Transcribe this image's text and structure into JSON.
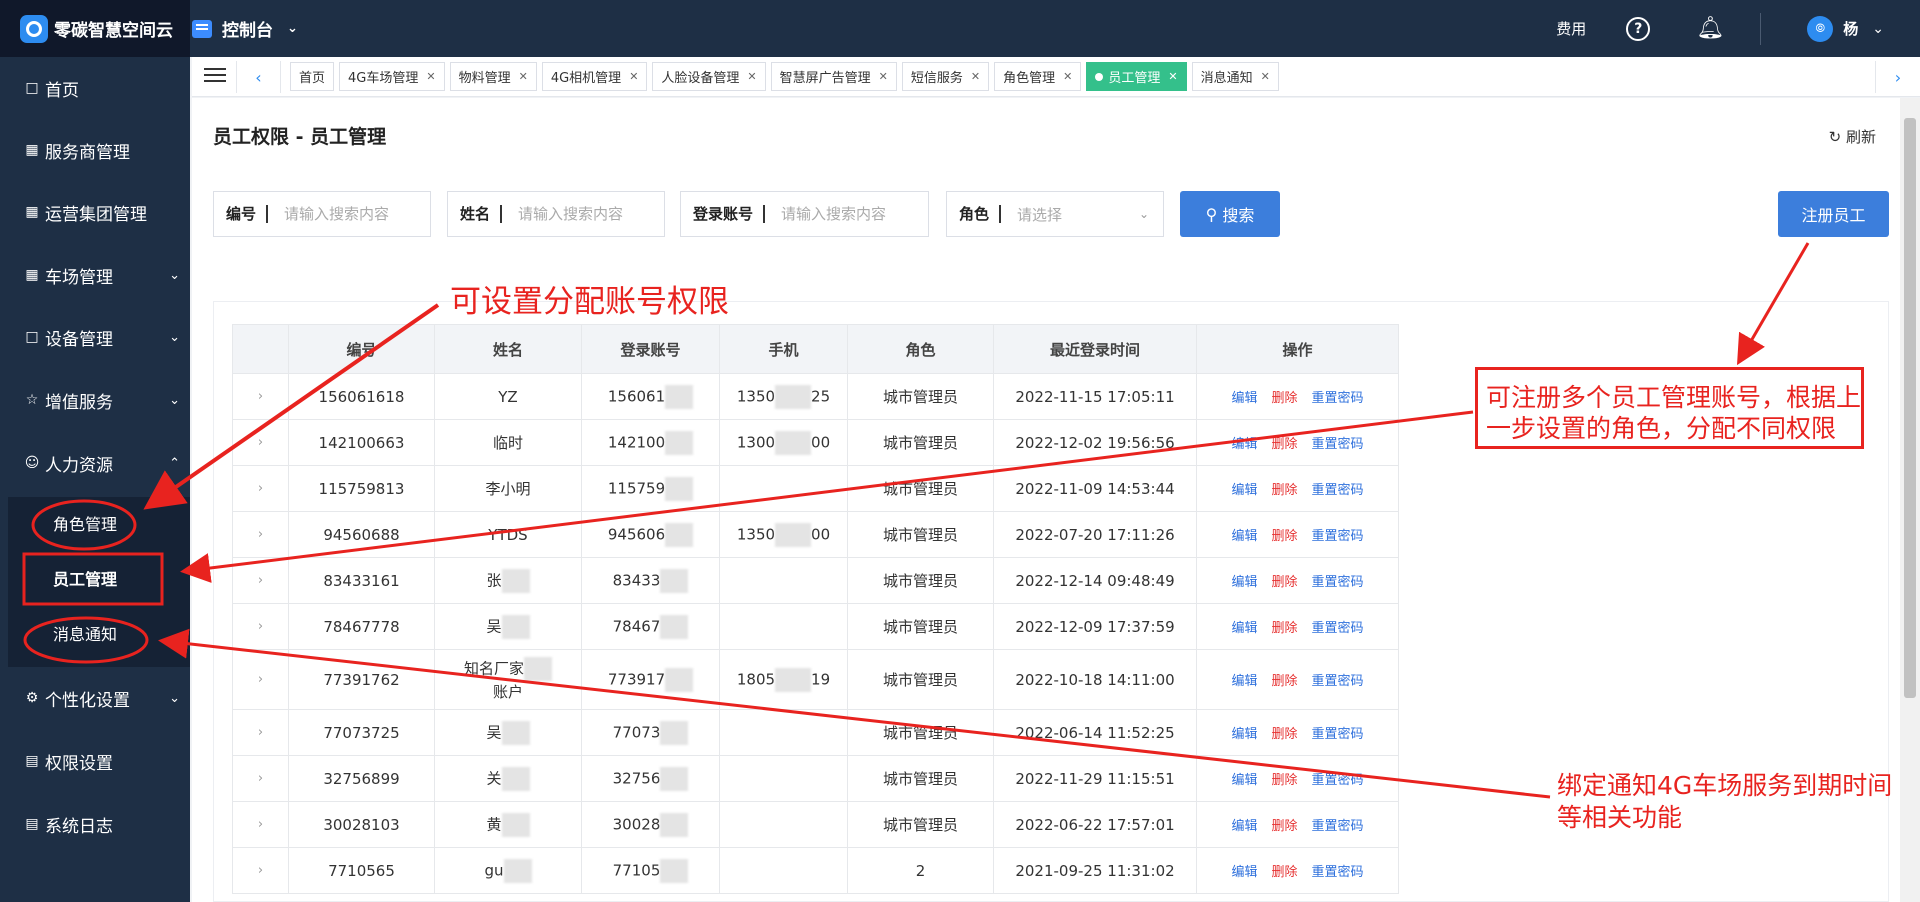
{
  "app": {
    "name": "零碳智慧空间云",
    "console_label": "控制台"
  },
  "topbar": {
    "fee_label": "费用",
    "help_label": "?",
    "user_name": "杨"
  },
  "sidebar": {
    "items": [
      {
        "label": "首页",
        "icon": "home-icon"
      },
      {
        "label": "服务商管理",
        "icon": "grid-icon"
      },
      {
        "label": "运营集团管理",
        "icon": "grid-icon"
      },
      {
        "label": "车场管理",
        "icon": "grid-icon"
      },
      {
        "label": "设备管理",
        "icon": "device-icon"
      },
      {
        "label": "增值服务",
        "icon": "star-icon"
      },
      {
        "label": "人力资源",
        "icon": "people-icon"
      },
      {
        "label": "个性化设置",
        "icon": "gear-icon"
      },
      {
        "label": "权限设置",
        "icon": "doc-icon"
      },
      {
        "label": "系统日志",
        "icon": "doc-icon"
      }
    ],
    "sub_items": [
      {
        "label": "角色管理"
      },
      {
        "label": "员工管理"
      },
      {
        "label": "消息通知"
      }
    ]
  },
  "tabs": [
    {
      "label": "首页"
    },
    {
      "label": "4G车场管理"
    },
    {
      "label": "物料管理"
    },
    {
      "label": "4G相机管理"
    },
    {
      "label": "人脸设备管理"
    },
    {
      "label": "智慧屏广告管理"
    },
    {
      "label": "短信服务"
    },
    {
      "label": "角色管理"
    },
    {
      "label": "员工管理"
    },
    {
      "label": "消息通知"
    }
  ],
  "page": {
    "title": "员工权限 - 员工管理",
    "refresh_label": "刷新",
    "filters": {
      "id_label": "编号",
      "id_placeholder": "请输入搜索内容",
      "name_label": "姓名",
      "name_placeholder": "请输入搜索内容",
      "account_label": "登录账号",
      "account_placeholder": "请输入搜索内容",
      "role_label": "角色",
      "role_placeholder": "请选择"
    },
    "search_label": "搜索",
    "register_label": "注册员工"
  },
  "table": {
    "headers": [
      "编号",
      "姓名",
      "登录账号",
      "手机",
      "角色",
      "最近登录时间",
      "操作"
    ],
    "actions": {
      "edit": "编辑",
      "delete": "删除",
      "reset": "重置密码"
    },
    "rows": [
      {
        "id": "156061618",
        "name": "YZ",
        "account": "156061",
        "phone_a": "1350",
        "phone_b": "25",
        "role": "城市管理员",
        "time": "2022-11-15 17:05:11"
      },
      {
        "id": "142100663",
        "name": "临时",
        "account": "142100",
        "phone_a": "1300",
        "phone_b": "00",
        "role": "城市管理员",
        "time": "2022-12-02 19:56:56"
      },
      {
        "id": "115759813",
        "name": "李小明",
        "account": "115759",
        "phone_a": "",
        "phone_b": "",
        "role": "城市管理员",
        "time": "2022-11-09 14:53:44"
      },
      {
        "id": "94560688",
        "name": "YTDS",
        "account": "945606",
        "phone_a": "1350",
        "phone_b": "00",
        "role": "城市管理员",
        "time": "2022-07-20 17:11:26"
      },
      {
        "id": "83433161",
        "name": "张",
        "account": "83433",
        "phone_a": "",
        "phone_b": "",
        "role": "城市管理员",
        "time": "2022-12-14 09:48:49"
      },
      {
        "id": "78467778",
        "name": "吴",
        "account": "78467",
        "phone_a": "",
        "phone_b": "",
        "role": "城市管理员",
        "time": "2022-12-09 17:37:59"
      },
      {
        "id": "77391762",
        "name": "知名厂家",
        "name2": "账户",
        "account": "773917",
        "phone_a": "1805",
        "phone_b": "19",
        "role": "城市管理员",
        "time": "2022-10-18 14:11:00"
      },
      {
        "id": "77073725",
        "name": "吴",
        "account": "77073",
        "phone_a": "",
        "phone_b": "",
        "role": "城市管理员",
        "time": "2022-06-14 11:52:25"
      },
      {
        "id": "32756899",
        "name": "关",
        "account": "32756",
        "phone_a": "",
        "phone_b": "",
        "role": "城市管理员",
        "time": "2022-11-29 11:15:51"
      },
      {
        "id": "30028103",
        "name": "黄",
        "account": "30028",
        "phone_a": "",
        "phone_b": "",
        "role": "城市管理员",
        "time": "2022-06-22 17:57:01"
      },
      {
        "id": "7710565",
        "name": "gu",
        "account": "77105",
        "phone_a": "",
        "phone_b": "",
        "role": "2",
        "time": "2021-09-25 11:31:02"
      }
    ]
  },
  "annotations": {
    "permission_note": "可设置分配账号权限",
    "register_note_line1": "可注册多个员工管理账号，根据上",
    "register_note_line2": "一步设置的角色，分配不同权限",
    "notify_note_line1": "绑定通知4G车场服务到期时间",
    "notify_note_line2": "等相关功能",
    "color": "#e8231f"
  }
}
